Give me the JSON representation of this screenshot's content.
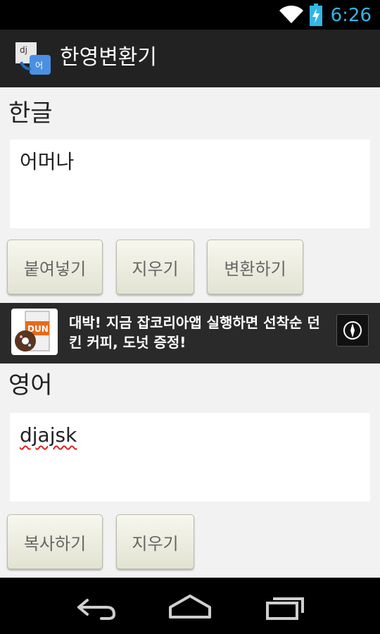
{
  "status": {
    "time": "6:26"
  },
  "app": {
    "title": "한영변환기",
    "icon_text_top": "dj",
    "icon_text_bottom": "어"
  },
  "korean": {
    "label": "한글",
    "value": "어머나",
    "buttons": {
      "paste": "붙여넣기",
      "clear": "지우기",
      "convert": "변환하기"
    }
  },
  "ad": {
    "text": "대박! 지금 잡코리아앱 실행하면 선착순 던킨 커피, 도넛 증정!",
    "thumb_text": "DUN"
  },
  "english": {
    "label": "영어",
    "value": "djajsk",
    "buttons": {
      "copy": "복사하기",
      "clear": "지우기"
    }
  },
  "colors": {
    "accent": "#33b5e5",
    "spell_error": "#e02020"
  }
}
